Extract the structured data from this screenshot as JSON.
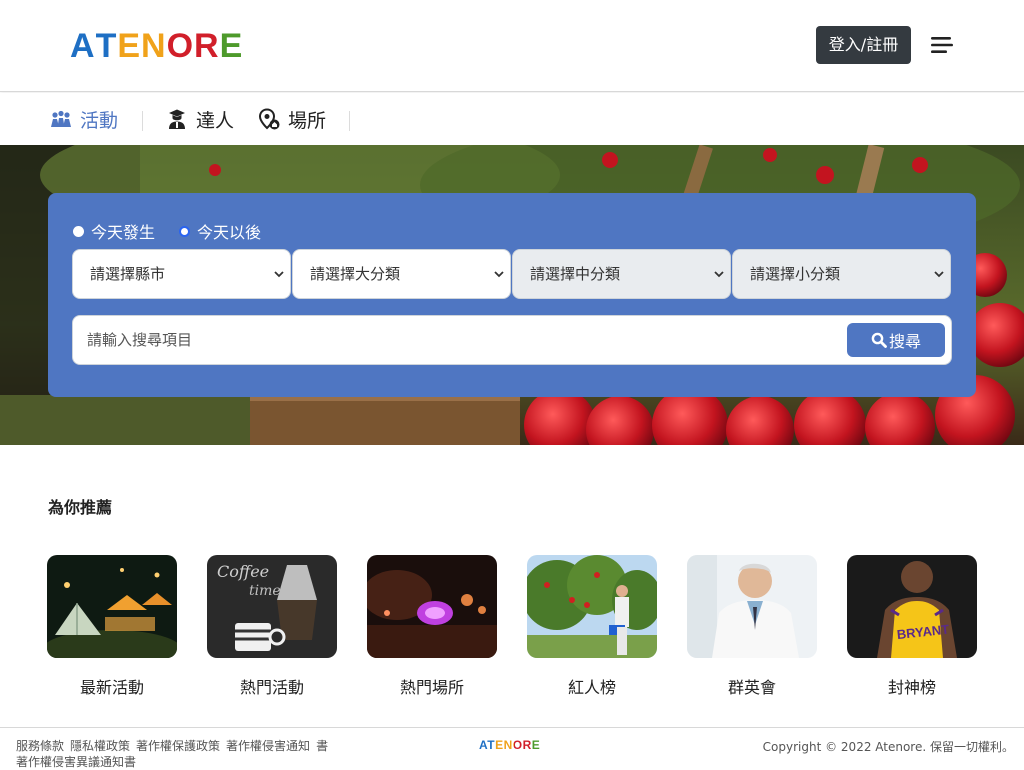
{
  "header": {
    "logo_letters": [
      "A",
      "T",
      "E",
      "N",
      "O",
      "R",
      "E"
    ],
    "logo_colors": [
      "#1e6fc4",
      "#1e6fc4",
      "#f0a21a",
      "#f0a21a",
      "#d11f2a",
      "#d11f2a",
      "#4e9a2b"
    ],
    "login_label": "登入/註冊",
    "menu_icon": "hamburger-icon"
  },
  "nav": {
    "items": [
      {
        "label": "活動",
        "icon": "activity-icon",
        "active": true
      },
      {
        "label": "達人",
        "icon": "expert-icon",
        "active": false
      },
      {
        "label": "場所",
        "icon": "place-icon",
        "active": false
      }
    ]
  },
  "search": {
    "radio": [
      {
        "label": "今天發生",
        "checked": false
      },
      {
        "label": "今天以後",
        "checked": true
      }
    ],
    "selects": [
      {
        "label": "請選擇縣市",
        "disabled": false
      },
      {
        "label": "請選擇大分類",
        "disabled": false
      },
      {
        "label": "請選擇中分類",
        "disabled": true
      },
      {
        "label": "請選擇小分類",
        "disabled": true
      }
    ],
    "placeholder": "請輸入搜尋項目",
    "button_label": "搜尋"
  },
  "recommend": {
    "title": "為你推薦",
    "cards": [
      {
        "label": "最新活動",
        "image": "camping-tents-night"
      },
      {
        "label": "熱門活動",
        "image": "coffee-chalkboard"
      },
      {
        "label": "熱門場所",
        "image": "bar-purple-lights"
      },
      {
        "label": "紅人榜",
        "image": "apple-orchard-picker"
      },
      {
        "label": "群英會",
        "image": "doctor-white-coat"
      },
      {
        "label": "封神榜",
        "image": "basketball-player"
      }
    ]
  },
  "footer": {
    "links_line1": [
      "服務條款",
      "隱私權政策",
      "著作權保護政策",
      "著作權侵害通知"
    ],
    "links_line2": [
      "書",
      "著作權侵害異議通知書"
    ],
    "logo": "ATENORE",
    "copyright": "Copyright © 2022 Atenore. 保留一切權利。"
  },
  "colors": {
    "accent": "#4f76c2",
    "dark_button": "#343a40",
    "active_nav": "#4f76c2"
  }
}
